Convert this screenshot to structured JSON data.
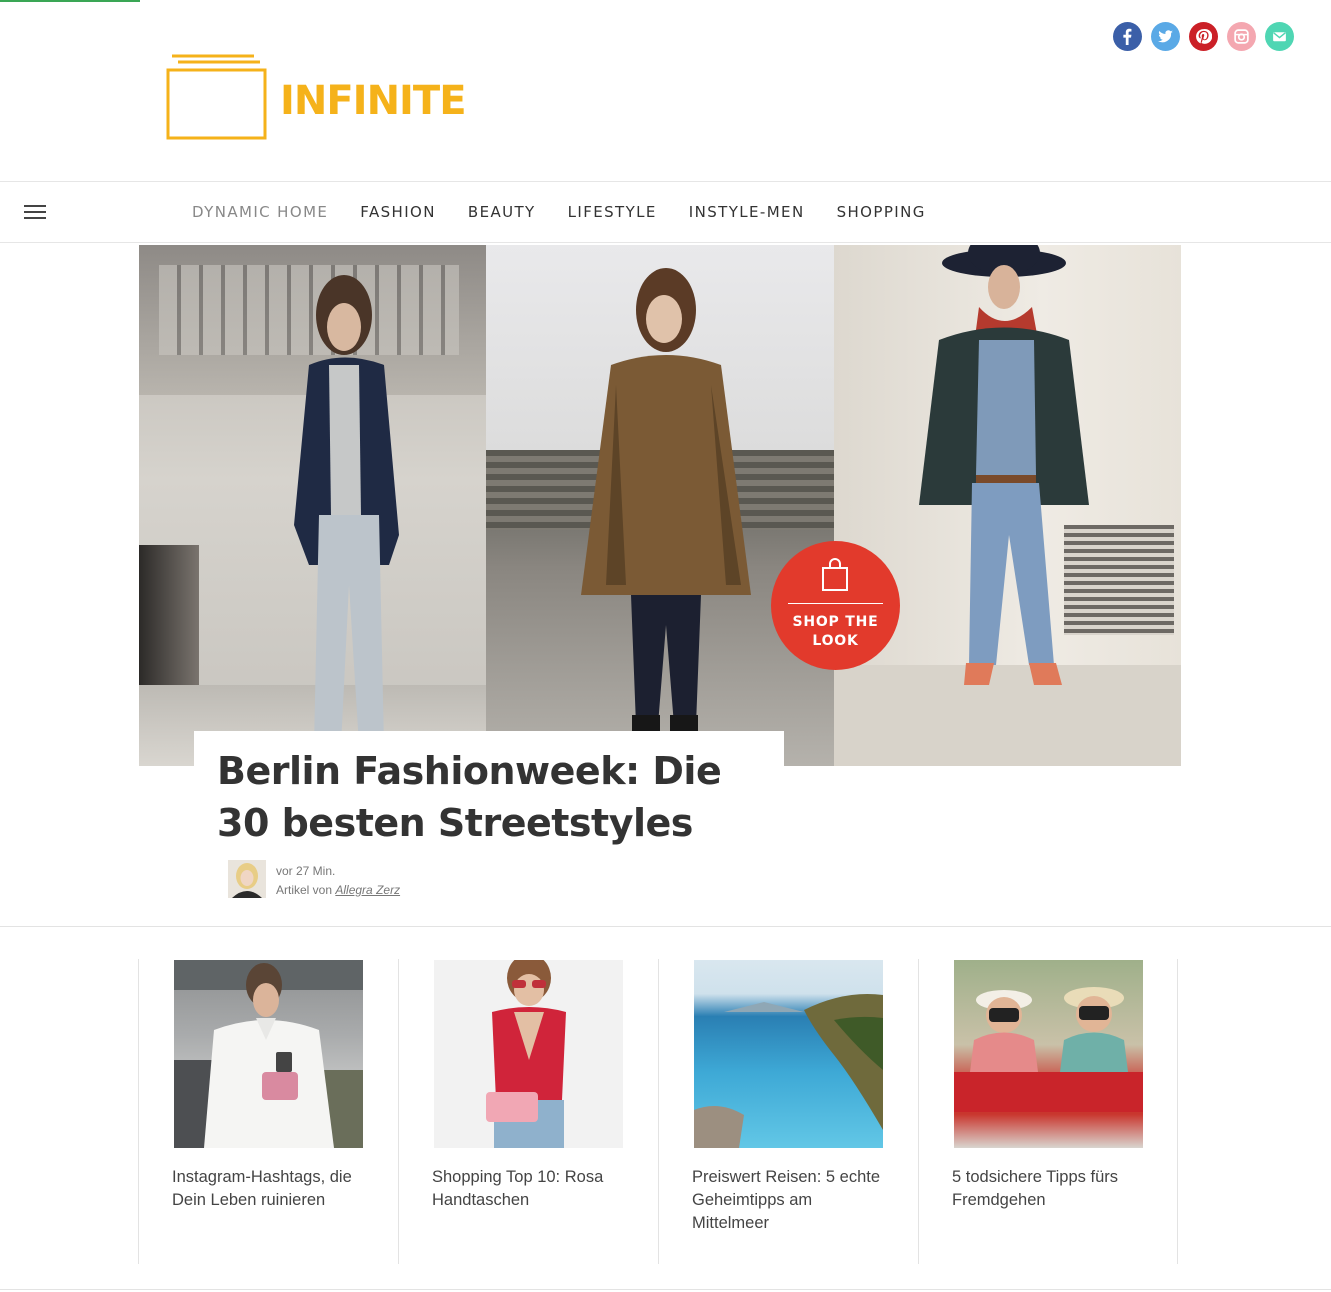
{
  "brand": {
    "name": "INFINITE",
    "color": "#f5b21a"
  },
  "social": [
    {
      "name": "facebook-icon",
      "color": "#3b5fa8"
    },
    {
      "name": "twitter-icon",
      "color": "#5aa9e6"
    },
    {
      "name": "pinterest-icon",
      "color": "#cb2027"
    },
    {
      "name": "instagram-icon",
      "color": "#f4a7b0"
    },
    {
      "name": "email-icon",
      "color": "#4fd6b3"
    }
  ],
  "nav": {
    "items": [
      "DYNAMIC HOME",
      "FASHION",
      "BEAUTY",
      "LIFESTYLE",
      "INSTYLE-MEN",
      "SHOPPING"
    ],
    "active": "DYNAMIC HOME"
  },
  "hero": {
    "badge_line1": "SHOP THE",
    "badge_line2": "LOOK",
    "badge_color": "#e23a2c",
    "headline": "Berlin Fashionweek: Die 30 besten Streetstyles",
    "time": "vor 27 Min.",
    "author_prefix": "Artikel von",
    "author": "Allegra Zerz"
  },
  "cards": [
    {
      "title": "Instagram-Hashtags, die Dein Leben ruinieren"
    },
    {
      "title": "Shopping Top 10: Rosa Handtaschen"
    },
    {
      "title": "Preiswert Reisen: 5 echte Geheimtipps am Mittelmeer"
    },
    {
      "title": "5 todsichere Tipps fürs Fremdgehen"
    }
  ]
}
